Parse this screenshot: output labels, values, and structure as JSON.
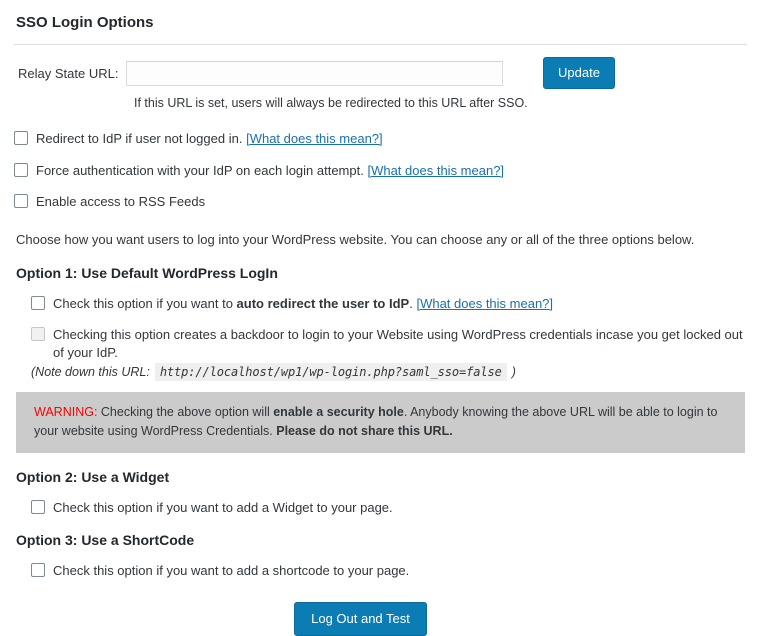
{
  "page": {
    "title": "SSO Login Options"
  },
  "relay": {
    "label": "Relay State URL:",
    "value": "",
    "placeholder": "",
    "update_label": "Update",
    "help": "If this URL is set, users will always be redirected to this URL after SSO."
  },
  "global_options": [
    {
      "label": "Redirect to IdP if user not logged in.",
      "link": "[What does this mean?]",
      "checked": false
    },
    {
      "label": "Force authentication with your IdP on each login attempt.",
      "link": "[What does this mean?]",
      "checked": false
    },
    {
      "label": "Enable access to RSS Feeds",
      "link": "",
      "checked": false
    }
  ],
  "intro": "Choose how you want users to log into your WordPress website. You can choose any or all of the three options below.",
  "option1": {
    "heading": "Option 1: Use Default WordPress LogIn",
    "auto_redirect": {
      "text_before": "Check this option if you want to ",
      "text_bold": "auto redirect the user to IdP",
      "text_after": ".",
      "link": "[What does this mean?]",
      "checked": false
    },
    "backdoor": {
      "text": "Checking this option creates a backdoor to login to your Website using WordPress credentials incase you get locked out of your IdP.",
      "checked": false,
      "disabled": true
    },
    "note_prefix": "(Note down this URL:",
    "note_url": "http://localhost/wp1/wp-login.php?saml_sso=false",
    "note_suffix": ")",
    "warning": {
      "word": "WARNING:",
      "part1": " Checking the above option will ",
      "bold1": "enable a security hole",
      "part2": ". Anybody knowing the above URL will be able to login to your website using WordPress Credentials. ",
      "bold2": "Please do not share this URL."
    }
  },
  "option2": {
    "heading": "Option 2: Use a Widget",
    "checkbox_label": "Check this option if you want to add a Widget to your page.",
    "checked": false
  },
  "option3": {
    "heading": "Option 3: Use a ShortCode",
    "checkbox_label": "Check this option if you want to add a shortcode to your page.",
    "checked": false
  },
  "footer": {
    "logout_test_label": "Log Out and Test"
  },
  "colors": {
    "accent": "#0c7cb5",
    "warning_text": "#ff0000",
    "warning_bg": "#cbcbcb",
    "link": "#1a6fb3"
  }
}
